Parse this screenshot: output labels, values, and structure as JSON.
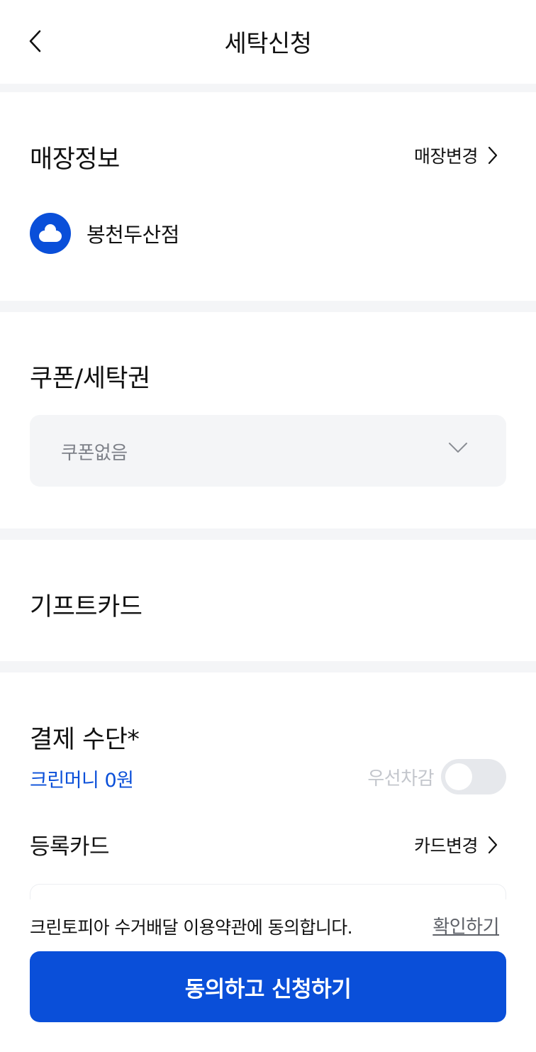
{
  "header": {
    "title": "세탁신청"
  },
  "store": {
    "section_title": "매장정보",
    "change_label": "매장변경",
    "name": "봉천두산점"
  },
  "coupon": {
    "section_title": "쿠폰/세탁권",
    "selected": "쿠폰없음"
  },
  "giftcard": {
    "section_title": "기프트카드"
  },
  "payment": {
    "section_title": "결제 수단*",
    "cleanmoney": "크린머니 0원",
    "priority_label": "우선차감",
    "priority_enabled": false,
    "card_label": "등록카드",
    "card_change_label": "카드변경"
  },
  "footer": {
    "terms_text": "크린토피아 수거배달 이용약관에 동의합니다.",
    "terms_link": "확인하기",
    "submit_label": "동의하고 신청하기"
  },
  "colors": {
    "accent": "#0a4fd9",
    "divider": "#f4f5f7",
    "muted": "#7d8088"
  }
}
